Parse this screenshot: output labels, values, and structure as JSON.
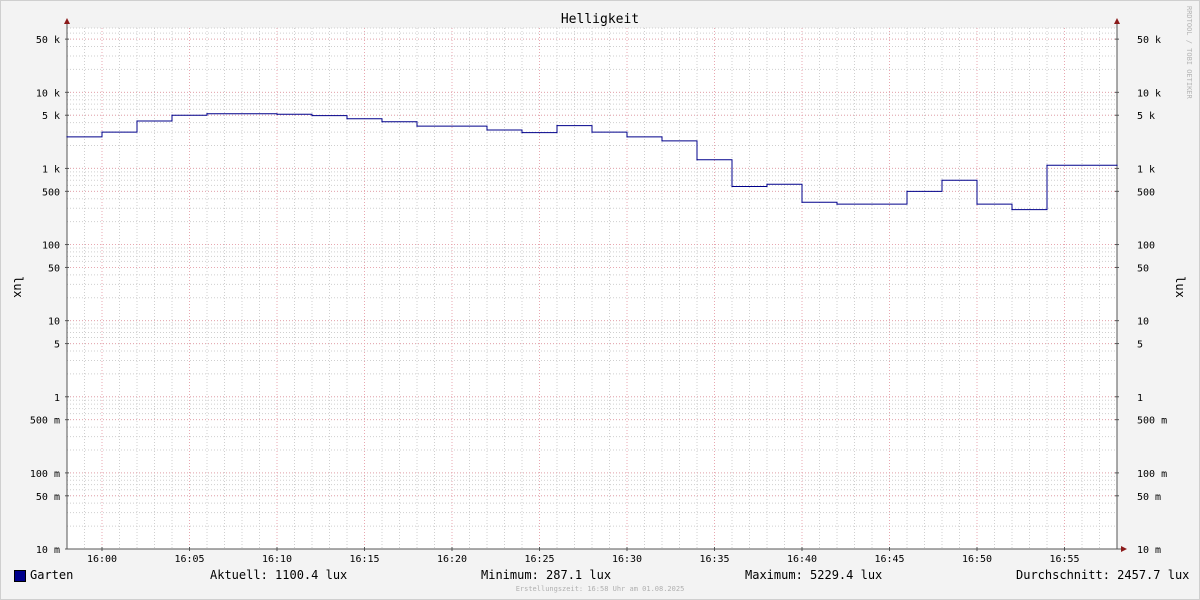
{
  "chart_data": {
    "type": "line",
    "title": "Helligkeit",
    "ylabel": "lux",
    "yscale": "log",
    "ylim": [
      0.01,
      70000
    ],
    "y_ticks": [
      {
        "value": 50000,
        "label": "50 k"
      },
      {
        "value": 10000,
        "label": "10 k"
      },
      {
        "value": 5000,
        "label": "5 k"
      },
      {
        "value": 1000,
        "label": "1 k"
      },
      {
        "value": 500,
        "label": "500"
      },
      {
        "value": 100,
        "label": "100"
      },
      {
        "value": 50,
        "label": "50"
      },
      {
        "value": 10,
        "label": "10"
      },
      {
        "value": 5,
        "label": "5"
      },
      {
        "value": 1,
        "label": "1"
      },
      {
        "value": 0.5,
        "label": "500 m"
      },
      {
        "value": 0.1,
        "label": "100 m"
      },
      {
        "value": 0.05,
        "label": "50 m"
      },
      {
        "value": 0.01,
        "label": "10 m"
      }
    ],
    "xlim": [
      "15:58",
      "16:58"
    ],
    "x_ticks": [
      "16:00",
      "16:05",
      "16:10",
      "16:15",
      "16:20",
      "16:25",
      "16:30",
      "16:35",
      "16:40",
      "16:45",
      "16:50",
      "16:55"
    ],
    "grid": true,
    "series": [
      {
        "name": "Garten",
        "color": "#00008b",
        "step": true,
        "points": [
          {
            "x": "15:58",
            "y": 2600
          },
          {
            "x": "16:00",
            "y": 3000
          },
          {
            "x": "16:02",
            "y": 4200
          },
          {
            "x": "16:04",
            "y": 5000
          },
          {
            "x": "16:06",
            "y": 5229.4
          },
          {
            "x": "16:10",
            "y": 5150
          },
          {
            "x": "16:12",
            "y": 4950
          },
          {
            "x": "16:14",
            "y": 4500
          },
          {
            "x": "16:16",
            "y": 4100
          },
          {
            "x": "16:18",
            "y": 3600
          },
          {
            "x": "16:22",
            "y": 3200
          },
          {
            "x": "16:24",
            "y": 2950
          },
          {
            "x": "16:26",
            "y": 3650
          },
          {
            "x": "16:28",
            "y": 3000
          },
          {
            "x": "16:30",
            "y": 2600
          },
          {
            "x": "16:32",
            "y": 2300
          },
          {
            "x": "16:34",
            "y": 1300
          },
          {
            "x": "16:36",
            "y": 580
          },
          {
            "x": "16:38",
            "y": 620
          },
          {
            "x": "16:40",
            "y": 360
          },
          {
            "x": "16:42",
            "y": 340
          },
          {
            "x": "16:46",
            "y": 500
          },
          {
            "x": "16:48",
            "y": 700
          },
          {
            "x": "16:50",
            "y": 340
          },
          {
            "x": "16:52",
            "y": 287.1
          },
          {
            "x": "16:54",
            "y": 1100.4
          },
          {
            "x": "16:58",
            "y": 1100.4
          }
        ]
      }
    ],
    "legend": {
      "position": "bottom",
      "label": "Garten",
      "color": "#00008b",
      "current": "Aktuell: 1100.4 lux",
      "minimum": "Minimum: 287.1 lux",
      "maximum": "Maximum: 5229.4 lux",
      "average": "Durchschnitt: 2457.7 lux"
    },
    "side_note": "RRDTOOL / TOBI OETIKER",
    "footer": "Erstellungszeit: 16:58 Uhr am 01.08.2025"
  },
  "colors": {
    "background": "#f3f3f3",
    "plot_background": "#ffffff",
    "major_grid": "#e8a7b0",
    "minor_grid": "#cfcfcf",
    "axis": "#555555",
    "arrow": "#8b1a1a"
  }
}
